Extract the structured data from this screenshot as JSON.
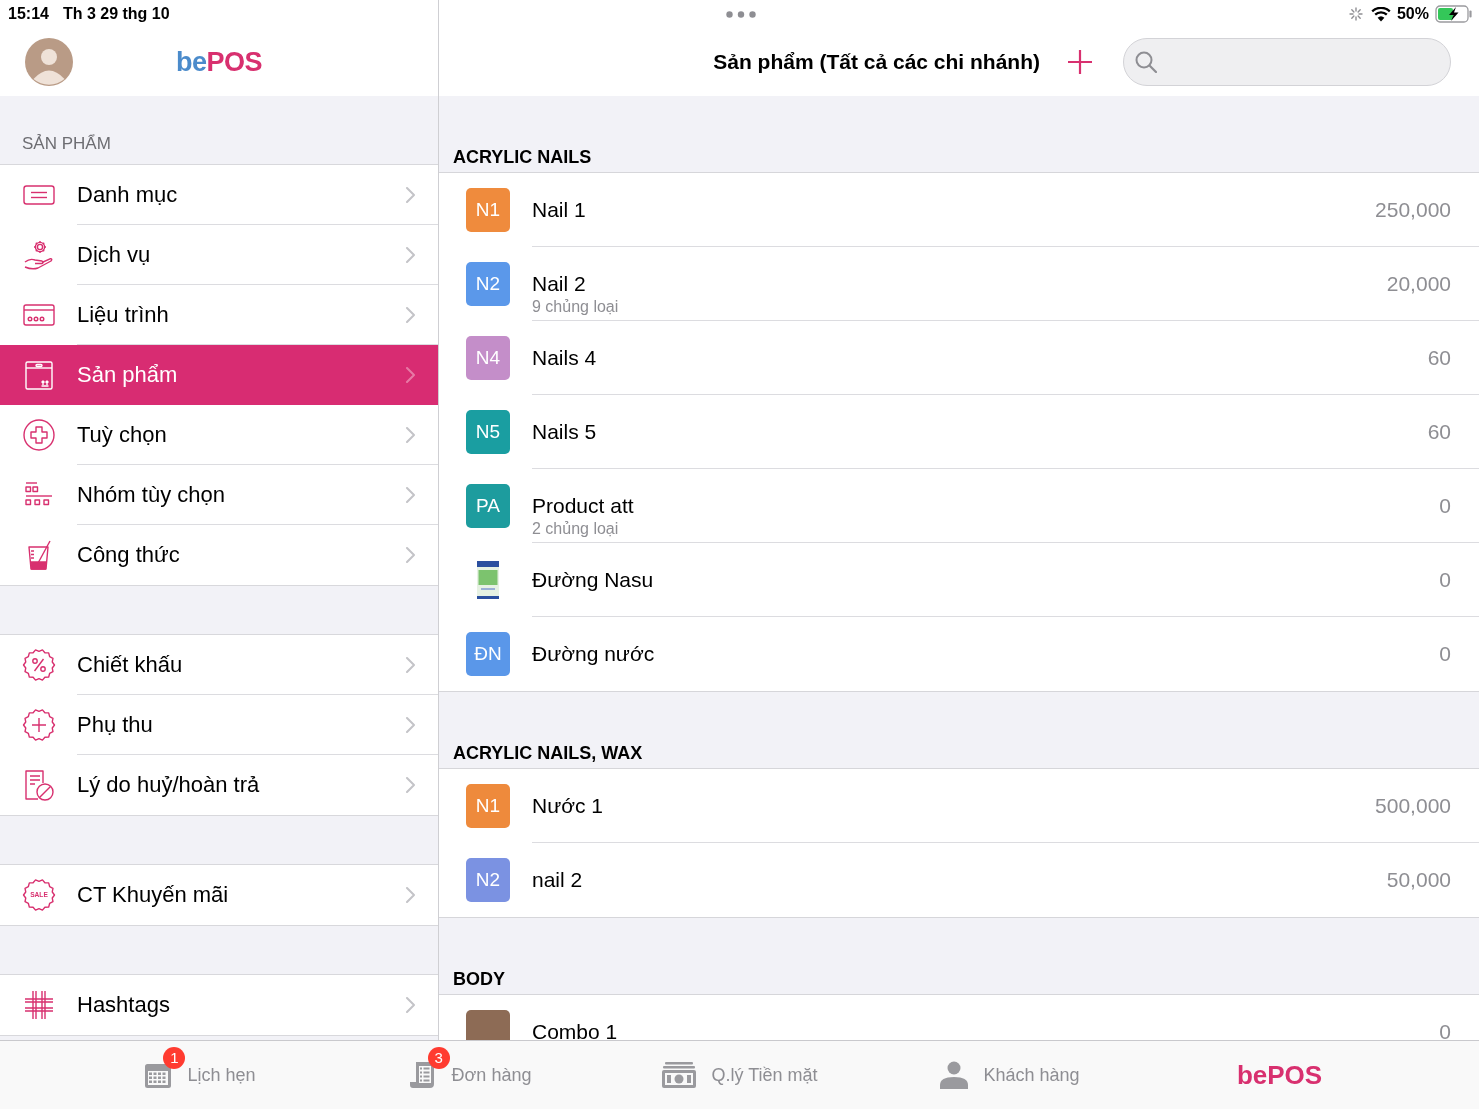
{
  "status_bar": {
    "time": "15:14",
    "date": "Th 3 29 thg 10",
    "battery": "50%"
  },
  "sidebar": {
    "logo": [
      {
        "text": "be",
        "color": "#4b8bcb"
      },
      {
        "text": "POS",
        "color": "#d8306f"
      }
    ],
    "groups": [
      {
        "header": "SẢN PHẨM",
        "items": [
          {
            "label": "Danh mục",
            "selected": false
          },
          {
            "label": "Dịch vụ",
            "selected": false
          },
          {
            "label": "Liệu trình",
            "selected": false
          },
          {
            "label": "Sản phẩm",
            "selected": true
          },
          {
            "label": "Tuỳ chọn",
            "selected": false
          },
          {
            "label": "Nhóm tùy chọn",
            "selected": false
          },
          {
            "label": "Công thức",
            "selected": false
          }
        ]
      },
      {
        "items": [
          {
            "label": "Chiết khấu",
            "selected": false
          },
          {
            "label": "Phụ thu",
            "selected": false
          },
          {
            "label": "Lý do huỷ/hoàn trả",
            "selected": false
          }
        ]
      },
      {
        "items": [
          {
            "label": "CT Khuyến mãi",
            "icon_text": "SALE",
            "selected": false
          }
        ]
      },
      {
        "items": [
          {
            "label": "Hashtags",
            "selected": false
          }
        ]
      }
    ]
  },
  "header": {
    "title": "Sản phẩm (Tất cả các chi nhánh)"
  },
  "product_sections": [
    {
      "title": "ACRYLIC NAILS",
      "items": [
        {
          "kind": "badge",
          "badge": "N1",
          "color": "#ef8b3d",
          "name": "Nail 1",
          "price": "250,000"
        },
        {
          "kind": "badge",
          "badge": "N2",
          "color": "#5b98ea",
          "name": "Nail 2",
          "subtitle": "9 chủng loại",
          "price": "20,000"
        },
        {
          "kind": "badge",
          "badge": "N4",
          "color": "#c48ec9",
          "name": "Nails 4",
          "price": "60"
        },
        {
          "kind": "badge",
          "badge": "N5",
          "color": "#1a9ea1",
          "name": "Nails 5",
          "price": "60"
        },
        {
          "kind": "badge",
          "badge": "PA",
          "color": "#1d9c9e",
          "name": "Product att",
          "subtitle": "2 chủng loại",
          "price": "0"
        },
        {
          "kind": "package",
          "name": "Đường Nasu",
          "price": "0"
        },
        {
          "kind": "badge",
          "badge": "ĐN",
          "color": "#5a97e9",
          "name": "Đường nước",
          "price": "0"
        }
      ]
    },
    {
      "title": "ACRYLIC NAILS, WAX",
      "items": [
        {
          "kind": "badge",
          "badge": "N1",
          "color": "#ee8a3c",
          "name": "Nước 1",
          "price": "500,000"
        },
        {
          "kind": "badge",
          "badge": "N2",
          "color": "#7b92e2",
          "name": "nail 2",
          "price": "50,000"
        }
      ]
    },
    {
      "title": "BODY",
      "items": [
        {
          "kind": "photo",
          "name": "Combo 1",
          "price": "0"
        }
      ]
    }
  ],
  "tab_bar": [
    {
      "kind": "icon",
      "label": "Lịch hẹn",
      "badge": "1",
      "selected": false
    },
    {
      "kind": "icon",
      "label": "Đơn hàng",
      "badge": "3",
      "selected": false
    },
    {
      "kind": "icon",
      "label": "Q.lý Tiền mặt",
      "selected": false
    },
    {
      "kind": "icon",
      "label": "Khách hàng",
      "selected": false
    },
    {
      "kind": "logo",
      "label": "bePOS",
      "selected": true
    }
  ]
}
